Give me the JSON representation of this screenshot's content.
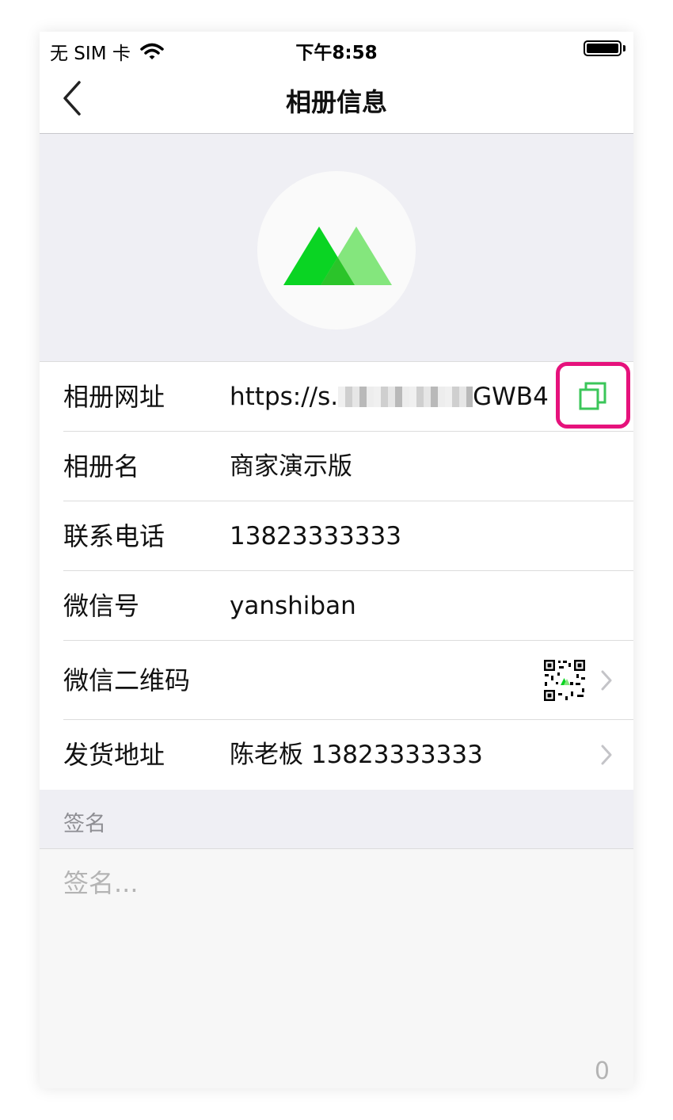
{
  "status_bar": {
    "carrier": "无 SIM 卡",
    "time": "下午8:58",
    "icons": [
      "wifi-icon",
      "battery-icon"
    ]
  },
  "nav": {
    "title": "相册信息",
    "back_icon": "chevron-left-icon"
  },
  "profile": {
    "avatar_icon": "green-mountains-logo",
    "colors": {
      "dark_green": "#0ad423",
      "light_green": "#84e67d"
    }
  },
  "info_rows": [
    {
      "label": "相册网址",
      "value_prefix": "https://s.",
      "value_suffix": "GWB4",
      "action_icon": "copy-icon"
    },
    {
      "label": "相册名",
      "value": "商家演示版"
    },
    {
      "label": "联系电话",
      "value": "13823333333"
    },
    {
      "label": "微信号",
      "value": "yanshiban"
    },
    {
      "label": "微信二维码",
      "value_icon": "qr-code-icon",
      "action_icon": "chevron-right-icon"
    },
    {
      "label": "发货地址",
      "value": "陈老板 13823333333",
      "action_icon": "chevron-right-icon"
    }
  ],
  "signature": {
    "section_title": "签名",
    "placeholder": "签名...",
    "char_count": "0"
  },
  "colors": {
    "accent_green": "#3bc65a",
    "highlight_pink": "#e6127c",
    "background_gray": "#efeff4"
  }
}
